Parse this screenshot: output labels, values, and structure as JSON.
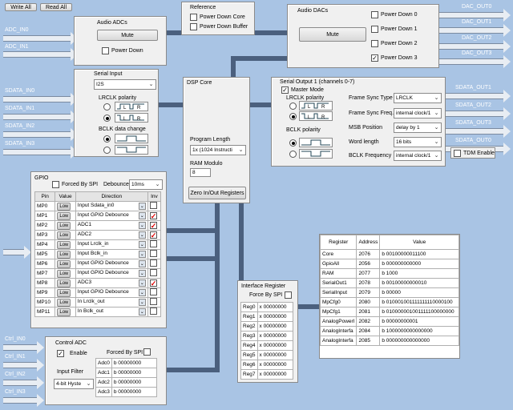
{
  "toolbar": {
    "write_all": "Write All",
    "read_all": "Read All"
  },
  "inputs": {
    "adc": [
      "ADC_IN0",
      "ADC_IN1"
    ],
    "sdata": [
      "SDATA_IN0",
      "SDATA_IN1",
      "SDATA_IN2",
      "SDATA_IN3"
    ],
    "ctrl": [
      "Ctrl_IN0",
      "Ctrl_IN1",
      "Ctrl_IN2",
      "Ctrl_IN3"
    ]
  },
  "outputs": {
    "dac": [
      "DAC_OUT0",
      "DAC_OUT1",
      "DAC_OUT2",
      "DAC_OUT3"
    ],
    "sdata": [
      "SDATA_OUT1",
      "SDATA_OUT2",
      "SDATA_OUT3",
      "SDATA_OUT0"
    ]
  },
  "audio_adcs": {
    "title": "Audio ADCs",
    "mute": "Mute",
    "power_down": "Power Down"
  },
  "reference": {
    "title": "Reference",
    "power_down_core": "Power Down Core",
    "power_down_buffer": "Power Down Buffer"
  },
  "audio_dacs": {
    "title": "Audio DACs",
    "mute": "Mute",
    "power_downs": [
      "Power Down 0",
      "Power Down 1",
      "Power Down 2",
      "Power Down 3"
    ],
    "checked": "✓"
  },
  "serial_input": {
    "title": "Serial Input",
    "format": "I2S",
    "lrclk_polarity": "LRCLK polarity",
    "bclk_change": "BCLK data change",
    "wave_l": "L",
    "wave_r": "R"
  },
  "dsp_core": {
    "title": "DSP Core",
    "program_length_label": "Program Length",
    "program_length": "1x (1024 Instructi",
    "ram_modulo_label": "RAM Modulo",
    "ram_modulo": "8",
    "zero_button": "Zero In/Out Registers"
  },
  "serial_output": {
    "title": "Serial Output 1 (channels 0-7)",
    "master_mode": "Master Mode",
    "master_checked": "✓",
    "lrclk_polarity": "LRCLK polarity",
    "bclk_polarity": "BCLK polarity",
    "fields": [
      {
        "label": "Frame Sync Type",
        "value": "LRCLK"
      },
      {
        "label": "Frame Sync Freq.",
        "value": "internal clock/1"
      },
      {
        "label": "MSB Position",
        "value": "delay by 1"
      },
      {
        "label": "Word length",
        "value": "16 bits"
      },
      {
        "label": "BCLK Frequency",
        "value": "internal clock/1"
      }
    ],
    "tdm_enable": "TDM Enable"
  },
  "gpio": {
    "title": "GPIO",
    "forced_by_spi": "Forced By SPI",
    "debounce_label": "Debounce",
    "debounce": "10ms",
    "headers": [
      "Pin",
      "Value",
      "Direction",
      "Inv"
    ],
    "rows": [
      {
        "pin": "MP0",
        "value": "Low",
        "direction": "Input  Sdata_in0",
        "inv": ""
      },
      {
        "pin": "MP1",
        "value": "Low",
        "direction": "Input  GPIO Debounce",
        "inv": "✓"
      },
      {
        "pin": "MP2",
        "value": "Low",
        "direction": "ADC1",
        "inv": "✓"
      },
      {
        "pin": "MP3",
        "value": "Low",
        "direction": "ADC2",
        "inv": "✓"
      },
      {
        "pin": "MP4",
        "value": "Low",
        "direction": "Input  Lrclk_in",
        "inv": ""
      },
      {
        "pin": "MP5",
        "value": "Low",
        "direction": "Input  Bclk_in",
        "inv": ""
      },
      {
        "pin": "MP6",
        "value": "Low",
        "direction": "Input  GPIO Debounce",
        "inv": ""
      },
      {
        "pin": "MP7",
        "value": "Low",
        "direction": "Input  GPIO Debounce",
        "inv": ""
      },
      {
        "pin": "MP8",
        "value": "Low",
        "direction": "ADC3",
        "inv": "✓"
      },
      {
        "pin": "MP9",
        "value": "Low",
        "direction": "Input  GPIO Debounce",
        "inv": ""
      },
      {
        "pin": "MP10",
        "value": "Low",
        "direction": "In Lrclk_out",
        "inv": ""
      },
      {
        "pin": "MP11",
        "value": "Low",
        "direction": "In Bclk_out",
        "inv": ""
      }
    ]
  },
  "control_adc": {
    "title": "Control ADC",
    "enable": "Enable",
    "enable_checked": "✓",
    "forced_by_spi": "Forced By SPI",
    "input_filter_label": "Input Filter",
    "input_filter": "4-bit Hyste",
    "regs": [
      {
        "name": "Adc0",
        "value": "b 00000000"
      },
      {
        "name": "Adc1",
        "value": "b 00000000"
      },
      {
        "name": "Adc2",
        "value": "b 00000000"
      },
      {
        "name": "Adc3",
        "value": "b 00000000"
      }
    ]
  },
  "interface_register": {
    "title": "Interface Register",
    "force_by_spi": "Force By SPI",
    "regs": [
      {
        "name": "Reg0",
        "value": "x 00000000"
      },
      {
        "name": "Reg1",
        "value": "x 00000000"
      },
      {
        "name": "Reg2",
        "value": "x 00000000"
      },
      {
        "name": "Reg3",
        "value": "x 00000000"
      },
      {
        "name": "Reg4",
        "value": "x 00000000"
      },
      {
        "name": "Reg5",
        "value": "x 00000000"
      },
      {
        "name": "Reg6",
        "value": "x 00000000"
      },
      {
        "name": "Reg7",
        "value": "x 00000000"
      }
    ]
  },
  "register_table": {
    "headers": [
      "Register",
      "Address",
      "Value"
    ],
    "rows": [
      {
        "register": "Core",
        "address": "2076",
        "value": "b 00100000011100"
      },
      {
        "register": "GpioAll",
        "address": "2056",
        "value": "b 000000000000"
      },
      {
        "register": "RAM",
        "address": "2077",
        "value": "b 1000"
      },
      {
        "register": "SerialOut1",
        "address": "2078",
        "value": "b 00100000000010"
      },
      {
        "register": "SerialInput",
        "address": "2079",
        "value": "b 00000"
      },
      {
        "register": "MpCfg0",
        "address": "2080",
        "value": "b 010001001111111110000100"
      },
      {
        "register": "MpCfg1",
        "address": "2081",
        "value": "b 010000001001111100000000"
      },
      {
        "register": "AnalogPowerI",
        "address": "2082",
        "value": "b 00000000001"
      },
      {
        "register": "AnalogInterfa",
        "address": "2084",
        "value": "b 1000000000000000"
      },
      {
        "register": "AnalogInterfa",
        "address": "2085",
        "value": "b 000000000000000"
      }
    ]
  },
  "colors": {
    "background": "#a9c4e4",
    "bus": "#4b607e",
    "panel": "#f0f0f0",
    "check_red": "#dd0000"
  }
}
